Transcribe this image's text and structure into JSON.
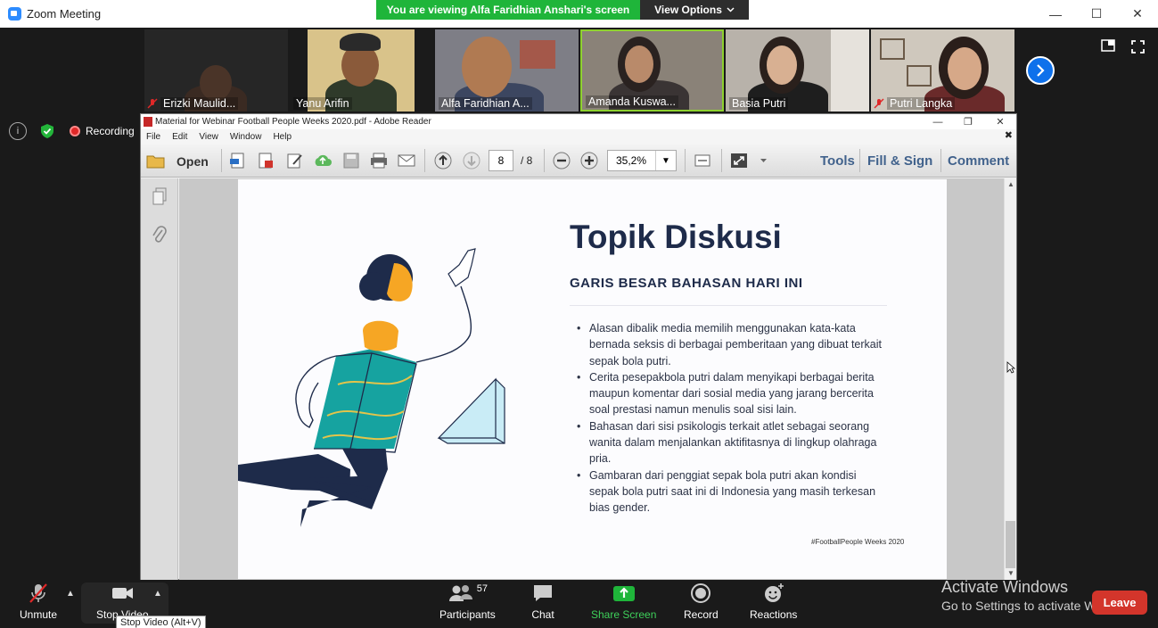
{
  "window": {
    "title": "Zoom Meeting",
    "controls": {
      "minimize": "—",
      "maximize": "☐",
      "close": "✕"
    }
  },
  "share_banner": {
    "viewing_text": "You are viewing Alfa Faridhian Anshari's screen",
    "view_options_label": "View Options"
  },
  "participants_gallery": [
    {
      "name": "Erizki Maulid...",
      "muted": true
    },
    {
      "name": "Yanu Arifin",
      "muted": false
    },
    {
      "name": "Alfa Faridhian A...",
      "muted": false
    },
    {
      "name": "Amanda Kuswa...",
      "muted": false,
      "active_speaker": true
    },
    {
      "name": "Basia Putri",
      "muted": false
    },
    {
      "name": "Putri Langka",
      "muted": true
    }
  ],
  "status": {
    "recording_label": "Recording"
  },
  "reader": {
    "title": "Material for Webinar Football People Weeks 2020.pdf - Adobe Reader",
    "menu": [
      "File",
      "Edit",
      "View",
      "Window",
      "Help"
    ],
    "toolbar": {
      "open_label": "Open",
      "current_page": "8",
      "total_pages": "/ 8",
      "zoom": "35,2%",
      "tools_label": "Tools",
      "fill_sign_label": "Fill & Sign",
      "comment_label": "Comment"
    }
  },
  "slide": {
    "title": "Topik Diskusi",
    "subtitle": "GARIS BESAR BAHASAN HARI INI",
    "bullets": [
      "Alasan dibalik media memilih menggunakan kata-kata bernada seksis di berbagai pemberitaan yang dibuat terkait sepak bola putri.",
      "Cerita pesepakbola putri dalam menyikapi berbagai berita maupun komentar dari sosial media yang jarang bercerita soal prestasi namun menulis soal sisi lain.",
      "Bahasan dari sisi psikologis terkait atlet sebagai seorang wanita dalam menjalankan aktifitasnya di lingkup olahraga pria.",
      "Gambaran dari penggiat sepak bola putri akan kondisi sepak bola putri saat ini di Indonesia yang masih terkesan bias gender."
    ],
    "hashtag": "#FootballPeople Weeks 2020"
  },
  "controls": {
    "unmute_label": "Unmute",
    "stop_video_label": "Stop Video",
    "stop_video_tooltip": "Stop Video (Alt+V)",
    "participants_label": "Participants",
    "participants_count": "57",
    "chat_label": "Chat",
    "share_screen_label": "Share Screen",
    "record_label": "Record",
    "reactions_label": "Reactions",
    "leave_label": "Leave"
  },
  "activation": {
    "line1": "Activate Windows",
    "line2": "Go to Settings to activate Windows."
  },
  "colors": {
    "share_green": "#1fb53a",
    "zoom_blue": "#0e71eb",
    "leave_red": "#d3352b",
    "slide_navy": "#1e2b4a",
    "figure_teal": "#16a3a0"
  }
}
